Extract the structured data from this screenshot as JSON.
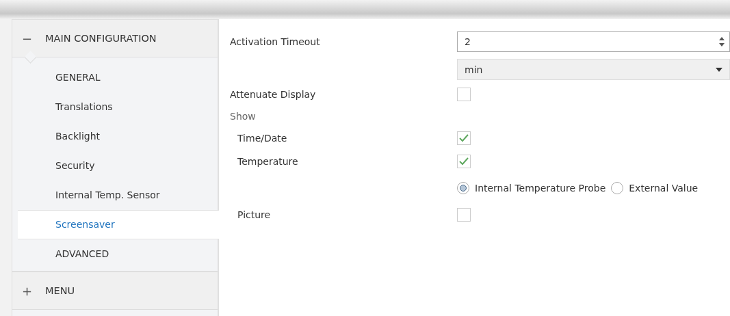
{
  "sidebar": {
    "groups": [
      {
        "symbol": "−",
        "label": "MAIN CONFIGURATION",
        "expanded": true,
        "items": [
          {
            "label": "GENERAL",
            "selected": false
          },
          {
            "label": "Translations",
            "selected": false
          },
          {
            "label": "Backlight",
            "selected": false
          },
          {
            "label": "Security",
            "selected": false
          },
          {
            "label": "Internal Temp. Sensor",
            "selected": false
          },
          {
            "label": "Screensaver",
            "selected": true
          },
          {
            "label": "ADVANCED",
            "selected": false
          }
        ]
      },
      {
        "symbol": "+",
        "label": "MENU",
        "expanded": false
      }
    ]
  },
  "settings": [
    {
      "kind": "number",
      "label": "Activation Timeout",
      "value": "2"
    },
    {
      "kind": "select",
      "value": "min"
    },
    {
      "kind": "checkbox",
      "label": "Attenuate Display",
      "checked": false
    },
    {
      "kind": "heading",
      "label": "Show"
    },
    {
      "kind": "checkbox",
      "label": "Time/Date",
      "checked": true,
      "indented": true
    },
    {
      "kind": "checkbox",
      "label": "Temperature",
      "checked": true,
      "indented": true
    },
    {
      "kind": "radio",
      "options": [
        {
          "label": "Internal Temperature Probe",
          "selected": true
        },
        {
          "label": "External Value",
          "selected": false
        }
      ]
    },
    {
      "kind": "checkbox",
      "label": "Picture",
      "checked": false,
      "indented": true
    }
  ]
}
